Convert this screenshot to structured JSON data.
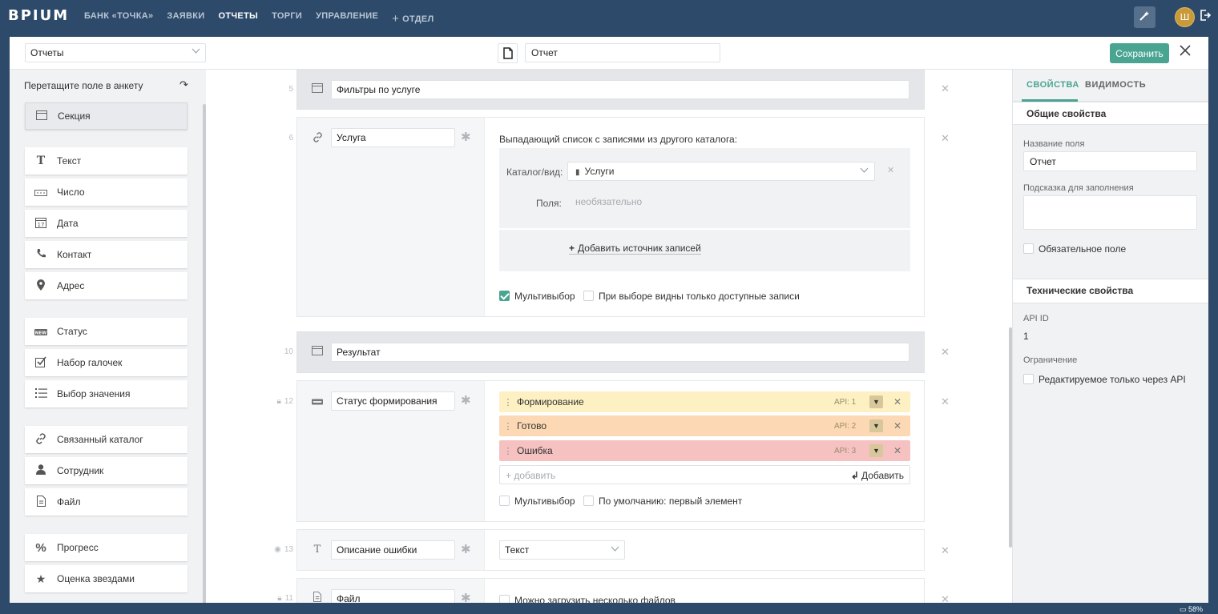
{
  "app": {
    "logo": "BPIUM"
  },
  "nav": {
    "items": [
      "БАНК «ТОЧКА»",
      "ЗАЯВКИ",
      "ОТЧЕТЫ",
      "ТОРГИ",
      "УПРАВЛЕНИЕ"
    ],
    "add_section": "ОТДЕЛ"
  },
  "user": {
    "initial": "Ш"
  },
  "toolbar": {
    "catalog_select": "Отчеты",
    "title_value": "Отчет",
    "save_label": "Сохранить"
  },
  "palette": {
    "title": "Перетащите поле в анкету",
    "items": [
      {
        "label": "Секция",
        "icon": "section-icon"
      },
      {
        "label": "Текст",
        "icon": "text-icon"
      },
      {
        "label": "Число",
        "icon": "number-icon"
      },
      {
        "label": "Дата",
        "icon": "calendar-icon"
      },
      {
        "label": "Контакт",
        "icon": "phone-icon"
      },
      {
        "label": "Адрес",
        "icon": "location-pin-icon"
      },
      {
        "label": "Статус",
        "icon": "status-icon"
      },
      {
        "label": "Набор галочек",
        "icon": "checkbox-icon"
      },
      {
        "label": "Выбор значения",
        "icon": "list-icon"
      },
      {
        "label": "Связанный каталог",
        "icon": "link-icon"
      },
      {
        "label": "Сотрудник",
        "icon": "user-icon"
      },
      {
        "label": "Файл",
        "icon": "file-icon"
      },
      {
        "label": "Прогресс",
        "icon": "percent-icon"
      },
      {
        "label": "Оценка звездами",
        "icon": "star-icon"
      }
    ]
  },
  "form": {
    "sections": [
      {
        "num": "5",
        "name": "Фильтры по услуге"
      },
      {
        "num": "10",
        "name": "Результат"
      }
    ],
    "service_field": {
      "num": "6",
      "name": "Услуга",
      "description": "Выпадающий список с записями из другого каталога:",
      "catalog_label": "Каталог/вид:",
      "catalog_value": "Услуги",
      "fields_label": "Поля:",
      "fields_placeholder": "необязательно",
      "add_source": "Добавить источник записей",
      "multiselect": "Мультивыбор",
      "only_available": "При выборе видны только доступные записи"
    },
    "status_field": {
      "num": "12",
      "name": "Статус формирования",
      "options": [
        {
          "label": "Формирование",
          "api": "API: 1",
          "color": "#fdf0c2"
        },
        {
          "label": "Готово",
          "api": "API: 2",
          "color": "#fcd9b4"
        },
        {
          "label": "Ошибка",
          "api": "API: 3",
          "color": "#f5c1c1"
        }
      ],
      "add_placeholder": "+ добавить",
      "add_button": "Добавить",
      "multiselect": "Мультивыбор",
      "default_first": "По умолчанию: первый элемент"
    },
    "error_field": {
      "num": "13",
      "name": "Описание ошибки",
      "type_value": "Текст"
    },
    "file_field": {
      "num": "11",
      "name": "Файл",
      "multi_files": "Можно загрузить несколько файлов"
    }
  },
  "props": {
    "tabs": [
      "СВОЙСТВА",
      "ВИДИМОСТЬ"
    ],
    "general_title": "Общие свойства",
    "field_name_label": "Название поля",
    "field_name_value": "Отчет",
    "hint_label": "Подсказка для заполнения",
    "required_label": "Обязательное поле",
    "tech_title": "Технические свойства",
    "api_id_label": "API ID",
    "api_id_value": "1",
    "restriction_label": "Ограничение",
    "api_only_label": "Редактируемое только через API"
  },
  "status_bar": {
    "battery": "58%"
  }
}
